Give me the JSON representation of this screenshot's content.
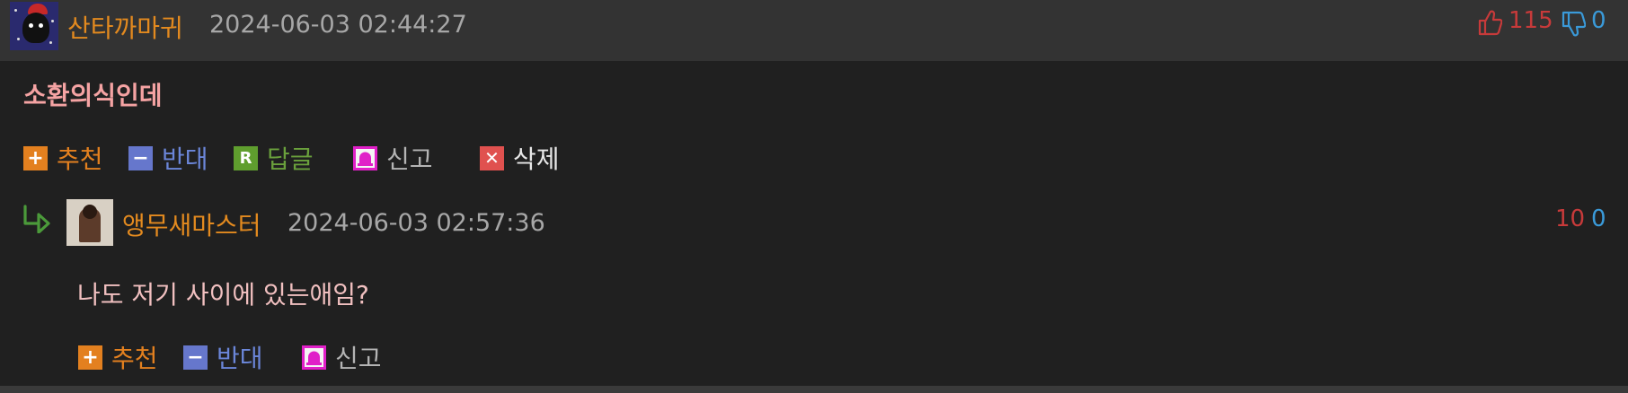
{
  "comment": {
    "author": "산타까마귀",
    "datetime": "2024-06-03 02:44:27",
    "upvotes": "115",
    "downvotes": "0",
    "text": "소환의식인데",
    "actions": {
      "recommend": "추천",
      "oppose": "반대",
      "reply": "답글",
      "report": "신고",
      "delete": "삭제"
    }
  },
  "reply": {
    "author": "앵무새마스터",
    "datetime": "2024-06-03 02:57:36",
    "upvotes": "10",
    "downvotes": "0",
    "text": "나도 저기 사이에 있는애임?",
    "actions": {
      "recommend": "추천",
      "oppose": "반대",
      "report": "신고"
    }
  },
  "icons": {
    "recommend": "plus-icon",
    "oppose": "minus-icon",
    "reply": "reply-r-icon",
    "report": "siren-icon",
    "delete": "close-icon",
    "thumbs_up": "thumbs-up-icon",
    "thumbs_down": "thumbs-down-icon",
    "reply_arrow": "reply-arrow-icon"
  },
  "colors": {
    "author": "#e38a1f",
    "upvote": "#c73a3a",
    "downvote": "#3a9ad9",
    "title": "#f5a3a3",
    "recommend": "#e3801f",
    "oppose": "#6677cc",
    "reply": "#5f9e2e",
    "report": "#e020c8",
    "delete": "#e0514f"
  }
}
